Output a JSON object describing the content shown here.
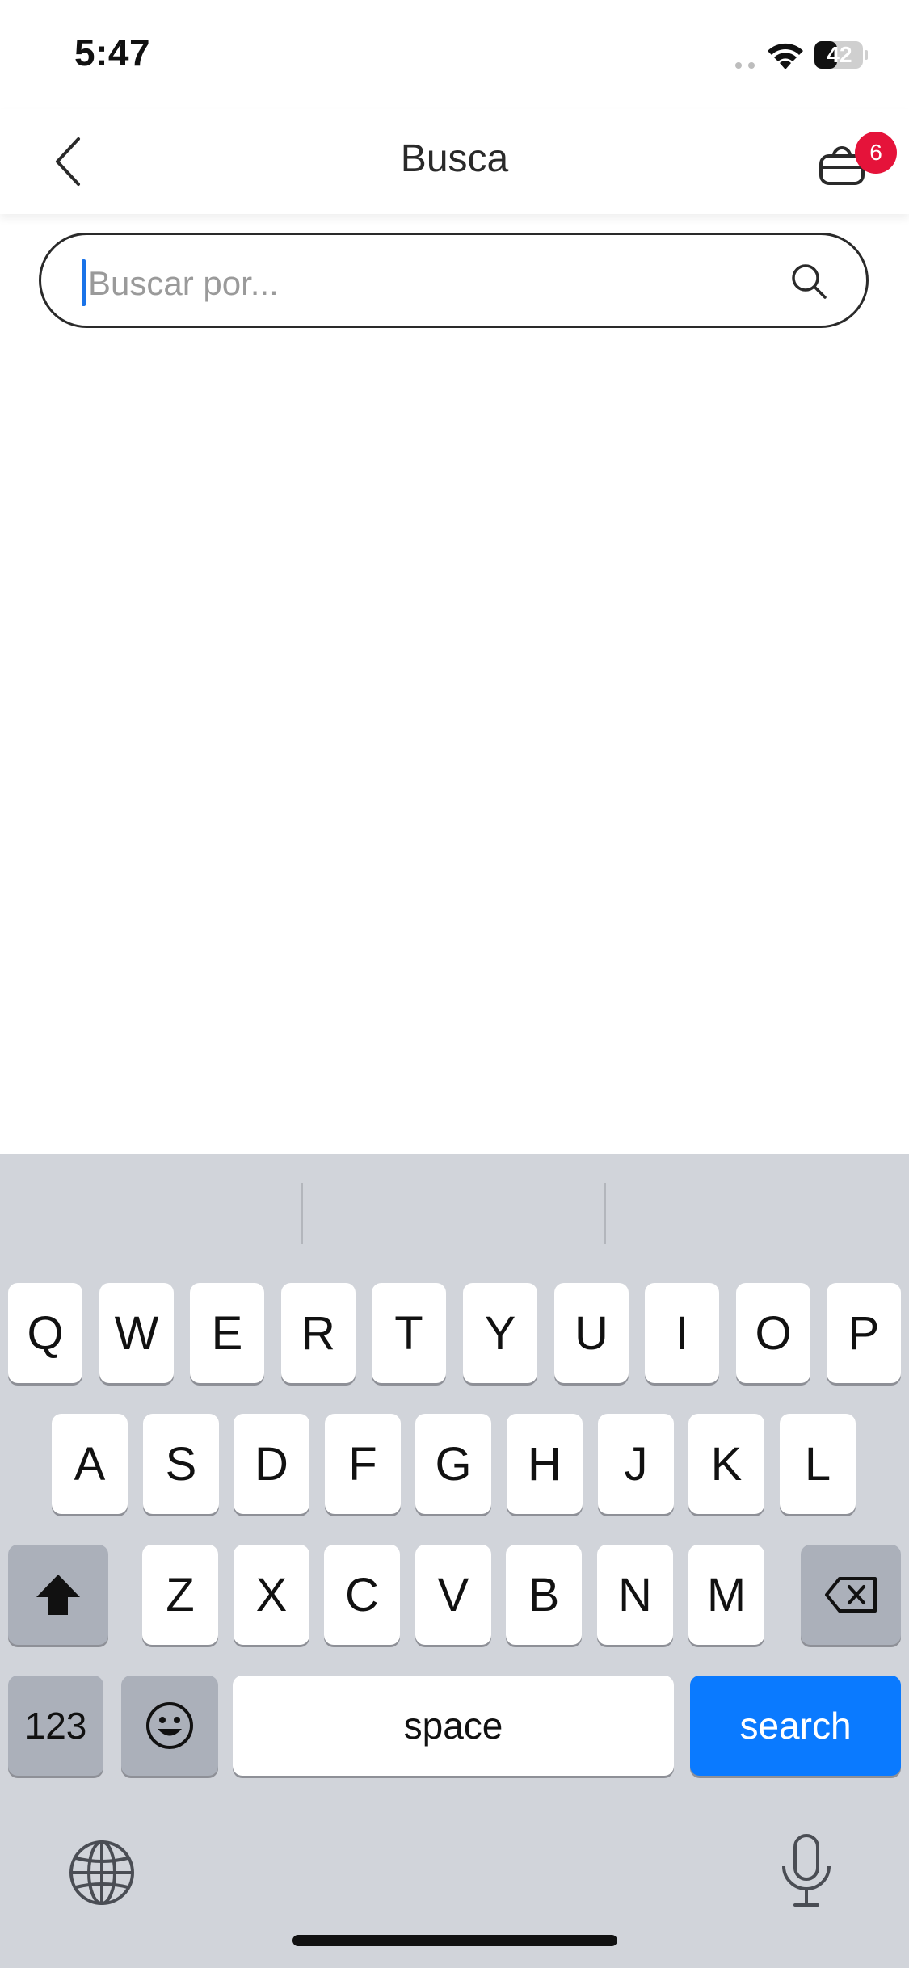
{
  "status_bar": {
    "time": "5:47",
    "battery_level": "42"
  },
  "header": {
    "title": "Busca",
    "back_icon": "chevron-left-icon",
    "bag_icon": "shopping-bag-icon",
    "bag_badge_count": "6",
    "badge_color": "#e5133a"
  },
  "search": {
    "placeholder": "Buscar por...",
    "value": "",
    "icon": "search-icon"
  },
  "keyboard": {
    "row1": [
      "Q",
      "W",
      "E",
      "R",
      "T",
      "Y",
      "U",
      "I",
      "O",
      "P"
    ],
    "row2": [
      "A",
      "S",
      "D",
      "F",
      "G",
      "H",
      "J",
      "K",
      "L"
    ],
    "row3": [
      "Z",
      "X",
      "C",
      "V",
      "B",
      "N",
      "M"
    ],
    "numbers_label": "123",
    "space_label": "space",
    "search_label": "search",
    "accent_color": "#0a7aff"
  }
}
